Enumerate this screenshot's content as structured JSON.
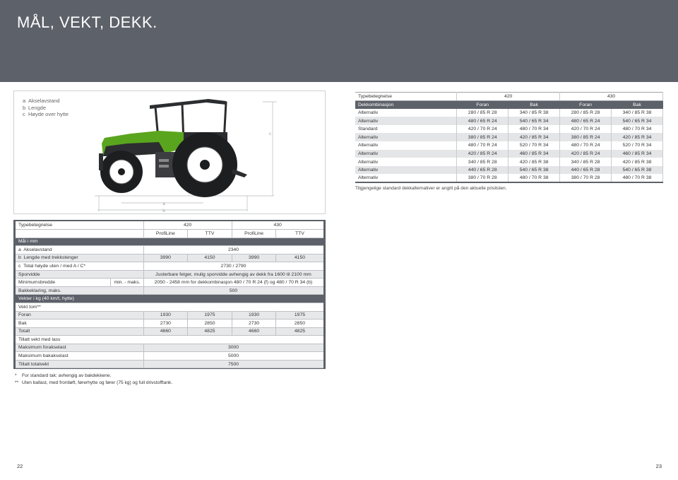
{
  "page_title": "MÅL, VEKT, DEKK.",
  "legend": [
    {
      "key": "a",
      "text": "Akselavstand"
    },
    {
      "key": "b",
      "text": "Lengde"
    },
    {
      "key": "c",
      "text": "Høyde over hytte"
    }
  ],
  "dim_labels": {
    "a": "a",
    "b": "b",
    "c": "c"
  },
  "colors": {
    "banner": "#5d6169",
    "tractor_green": "#5aa51e",
    "tractor_body": "#2c2d30"
  },
  "tyre_table": {
    "type_label": "Typebetegnelse",
    "models": [
      "420",
      "430"
    ],
    "combo_label": "Dekkombinasjon",
    "subheaders": [
      "Foran",
      "Bak",
      "Foran",
      "Bak"
    ],
    "rows": [
      {
        "label": "Alternativ",
        "cells": [
          "280 / 85 R 28",
          "340 / 85 R 38",
          "280 / 85 R 28",
          "340 / 85 R 38"
        ]
      },
      {
        "label": "Alternativ",
        "cells": [
          "480 / 65 R 24",
          "540 / 65 R 34",
          "480 / 65 R 24",
          "540 / 65 R 34"
        ]
      },
      {
        "label": "Standard",
        "cells": [
          "420 / 70 R 24",
          "480 / 70 R 34",
          "420 / 70 R 24",
          "480 / 70 R 34"
        ]
      },
      {
        "label": "Alternativ",
        "cells": [
          "380 / 85 R 24",
          "420 / 85 R 34",
          "380 / 85 R 24",
          "420 / 85 R 34"
        ]
      },
      {
        "label": "Alternativ",
        "cells": [
          "480 / 70 R 24",
          "520 / 70 R 34",
          "480 / 70 R 24",
          "520 / 70 R 34"
        ]
      },
      {
        "label": "Alternativ",
        "cells": [
          "420 / 85 R 24",
          "460 / 85 R 34",
          "420 / 85 R 24",
          "460 / 85 R 34"
        ]
      },
      {
        "label": "Alternativ",
        "cells": [
          "340 / 85 R 28",
          "420 / 85 R 38",
          "340 / 85 R 28",
          "420 / 85 R 38"
        ]
      },
      {
        "label": "Alternativ",
        "cells": [
          "440 / 65 R 28",
          "540 / 65 R 38",
          "440 / 65 R 28",
          "540 / 65 R 38"
        ]
      },
      {
        "label": "Alternativ",
        "cells": [
          "380 / 70 R 28",
          "480 / 70 R 38",
          "380 / 70 R 28",
          "480 / 70 R 38"
        ]
      }
    ],
    "note": "Tilgjengelige standard dekkalternativer er angitt på den aktuelle prislisten."
  },
  "spec_table": {
    "type_label": "Typebetegnelse",
    "models": [
      "420",
      "430"
    ],
    "variants": [
      "ProfiLine",
      "TTV",
      "ProfiLine",
      "TTV"
    ],
    "section_dims": "Mål i mm",
    "wheelbase": {
      "key": "a",
      "label": "Akselavstand",
      "value": "2340"
    },
    "length": {
      "key": "b",
      "label": "Lengde med trekkstenger",
      "values": [
        "3990",
        "4150",
        "3990",
        "4150"
      ]
    },
    "height": {
      "key": "c",
      "label": "Total høyde uten / med A / C*",
      "value": "2730 / 2790"
    },
    "track": {
      "label": "Sporvidde",
      "value": "Justerbare felger, mulig sporvidde avhengig av dekk fra 1600 til 2100 mm"
    },
    "min_width": {
      "label": "Minimumsbredde",
      "range_label": "min. - maks.",
      "value": "2050 - 2458 mm for dekkombinasjon 480 / 70 R 24 (f) og 480 / 70 R 34 (b)"
    },
    "clearance": {
      "label": "Bakkeklaring, maks.",
      "value": "500"
    },
    "section_weights": "Vekter i kg (40 km/t, hytte)",
    "weight_head": "Vekt tom**",
    "front": {
      "label": "Foran",
      "values": [
        "1930",
        "1975",
        "1930",
        "1975"
      ]
    },
    "rear": {
      "label": "Bak",
      "values": [
        "2730",
        "2850",
        "2730",
        "2850"
      ]
    },
    "total": {
      "label": "Totalt",
      "values": [
        "4660",
        "4825",
        "4660",
        "4825"
      ]
    },
    "allowed_head": "Tillatt vekt med lass",
    "max_front": {
      "label": "Maksimum forakselast",
      "value": "3000"
    },
    "max_rear": {
      "label": "Maksimum bakakselast",
      "value": "5000"
    },
    "allowed_total": {
      "label": "Tillatt totalvekt",
      "value": "7500"
    }
  },
  "footnotes": [
    {
      "mark": "*",
      "text": "For standard tak; avhengig av bakdekkene."
    },
    {
      "mark": "**",
      "text": "Uten ballast, med frontløft, førerhytte og fører (75 kg) og full drivstofftank."
    }
  ],
  "page_numbers": {
    "left": "22",
    "right": "23"
  }
}
